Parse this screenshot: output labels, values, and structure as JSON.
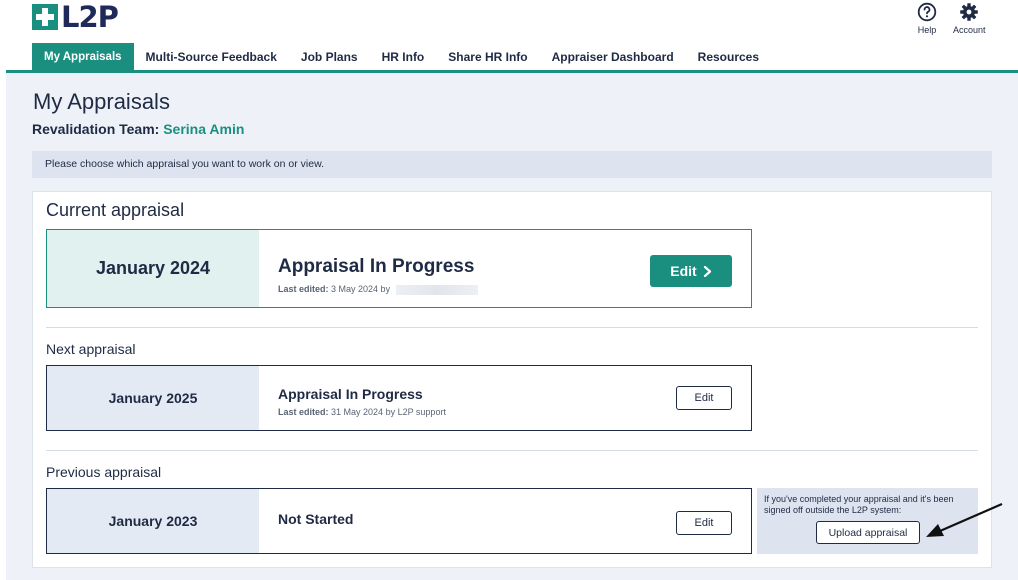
{
  "brand": {
    "logo_text": "L2P",
    "accent": "#1a8f80",
    "navy": "#1f2a44"
  },
  "header": {
    "help_label": "Help",
    "account_label": "Account",
    "help_icon": "question-circle-icon",
    "account_icon": "gear-icon"
  },
  "nav": {
    "tabs": [
      {
        "label": "My Appraisals",
        "active": true
      },
      {
        "label": "Multi-Source Feedback"
      },
      {
        "label": "Job Plans"
      },
      {
        "label": "HR Info"
      },
      {
        "label": "Share HR Info"
      },
      {
        "label": "Appraiser Dashboard"
      },
      {
        "label": "Resources"
      }
    ]
  },
  "page": {
    "title": "My Appraisals",
    "revalidation_label": "Revalidation Team: ",
    "revalidation_name": "Serina Amin",
    "info": "Please choose which appraisal you want to work on or view."
  },
  "current": {
    "section_title": "Current appraisal",
    "date": "January 2024",
    "status": "Appraisal In Progress",
    "edited_label": "Last edited:",
    "edited_value": "3 May 2024 by ",
    "edit_label": "Edit"
  },
  "next": {
    "section_title": "Next appraisal",
    "date": "January 2025",
    "status": "Appraisal In Progress",
    "edited_label": "Last edited:",
    "edited_value": "31 May 2024 by L2P support",
    "edit_label": "Edit"
  },
  "previous": {
    "section_title": "Previous appraisal",
    "date": "January 2023",
    "status": "Not Started",
    "edit_label": "Edit"
  },
  "upload": {
    "text": "If you've completed your appraisal and it's been signed off outside the L2P system:",
    "button_label": "Upload appraisal"
  }
}
